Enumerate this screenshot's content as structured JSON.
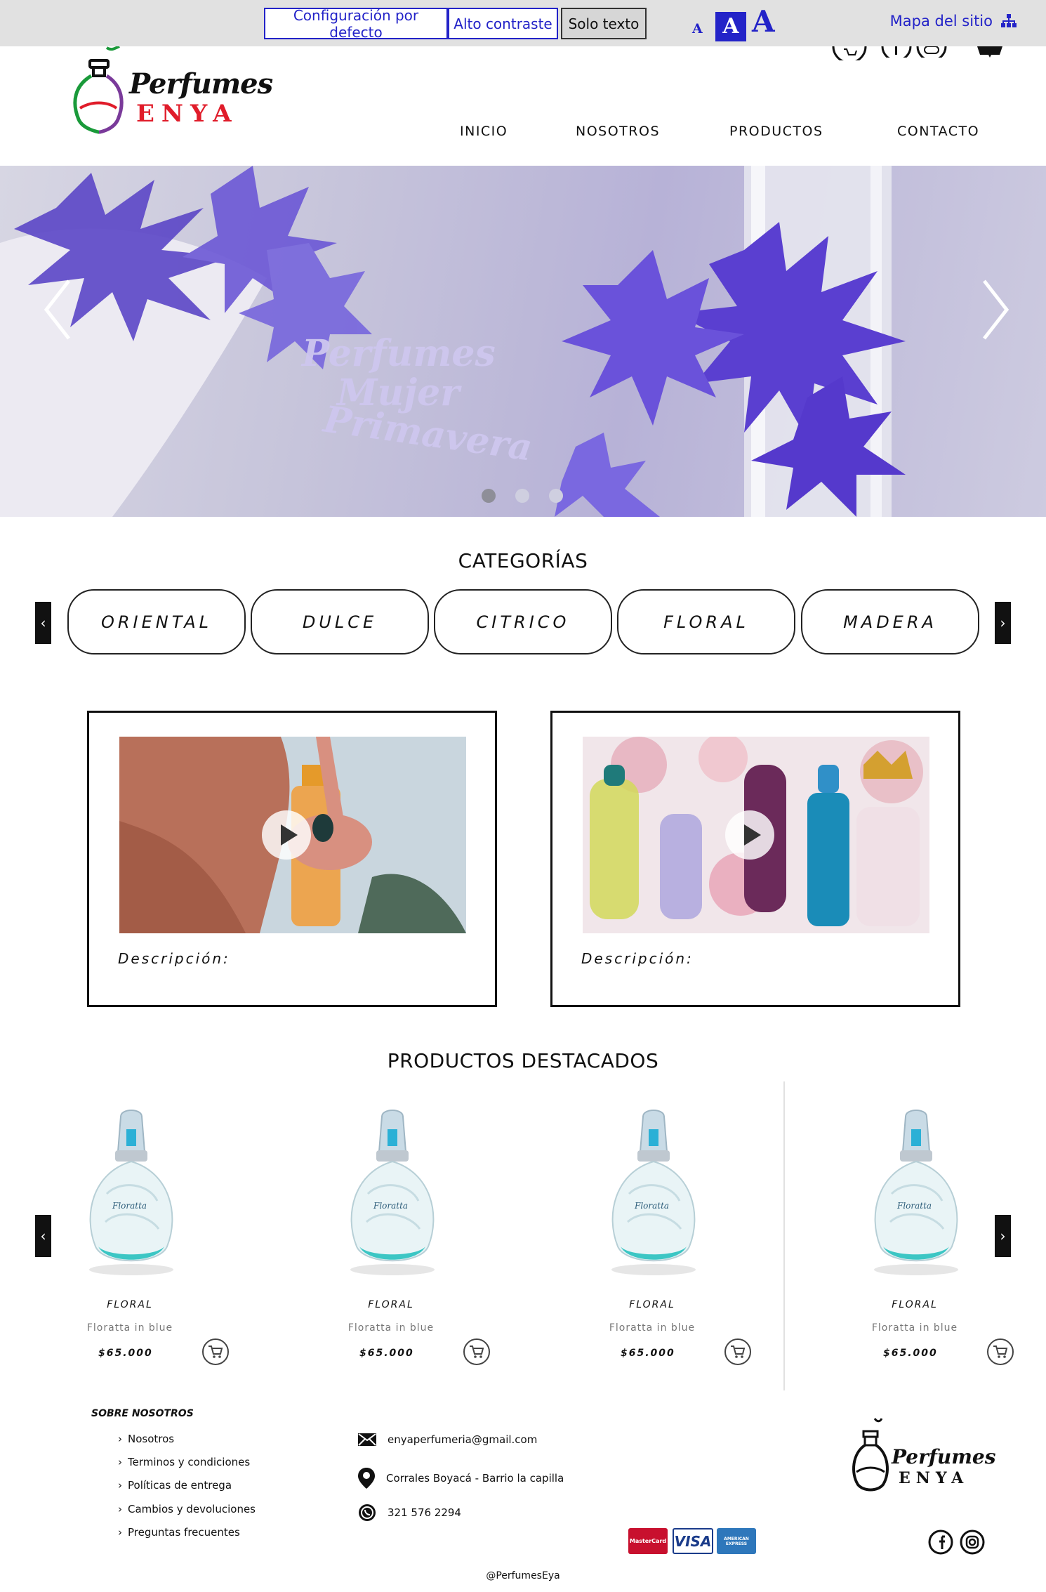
{
  "accessibility_bar": {
    "default_config": "Configuración por defecto",
    "high_contrast": "Alto contraste",
    "text_only": "Solo texto",
    "font_small": "A",
    "font_medium": "A",
    "font_large": "A",
    "sitemap": "Mapa del sitio"
  },
  "header": {
    "logo_script": "Perfumes",
    "logo_block": "ENYA",
    "nav": [
      "INICIO",
      "NOSOTROS",
      "PRODUCTOS",
      "CONTACTO"
    ]
  },
  "hero": {
    "slide_text": [
      "Perfumes",
      "Mujer",
      "Primavera"
    ],
    "dots": 3,
    "active_dot": 0
  },
  "categories": {
    "title": "CATEGORÍAS",
    "items": [
      "ORIENTAL",
      "DULCE",
      "CITRICO",
      "FLORAL",
      "MADERA"
    ]
  },
  "videos": [
    {
      "description": "Descripción:"
    },
    {
      "description": "Descripción:"
    }
  ],
  "featured": {
    "title": "PRODUCTOS DESTACADOS",
    "products": [
      {
        "category": "FLORAL",
        "name": "Floratta in blue",
        "price": "$65.000",
        "label": "Floratta"
      },
      {
        "category": "FLORAL",
        "name": "Floratta in blue",
        "price": "$65.000",
        "label": "Floratta"
      },
      {
        "category": "FLORAL",
        "name": "Floratta in blue",
        "price": "$65.000",
        "label": "Floratta"
      },
      {
        "category": "FLORAL",
        "name": "Floratta in blue",
        "price": "$65.000",
        "label": "Floratta"
      }
    ]
  },
  "footer": {
    "about_title": "SOBRE NOSOTROS",
    "links": [
      "Nosotros",
      "Terminos y condiciones",
      "Políticas de entrega",
      "Cambios y devoluciones",
      "Preguntas frecuentes"
    ],
    "email": "enyaperfumeria@gmail.com",
    "address": "Corrales Boyacá - Barrio la capilla",
    "phone": "321 576 2294",
    "logo_script": "Perfumes",
    "logo_block": "ENYA",
    "payments": [
      "MasterCard",
      "VISA",
      "AMERICAN EXPRESS"
    ],
    "handle": "@PerfumesEya"
  },
  "colors": {
    "accent_blue": "#2323c8",
    "brand_red": "#e01c2a",
    "brand_green": "#1a9a3a",
    "brand_purple": "#7a3a9a"
  }
}
